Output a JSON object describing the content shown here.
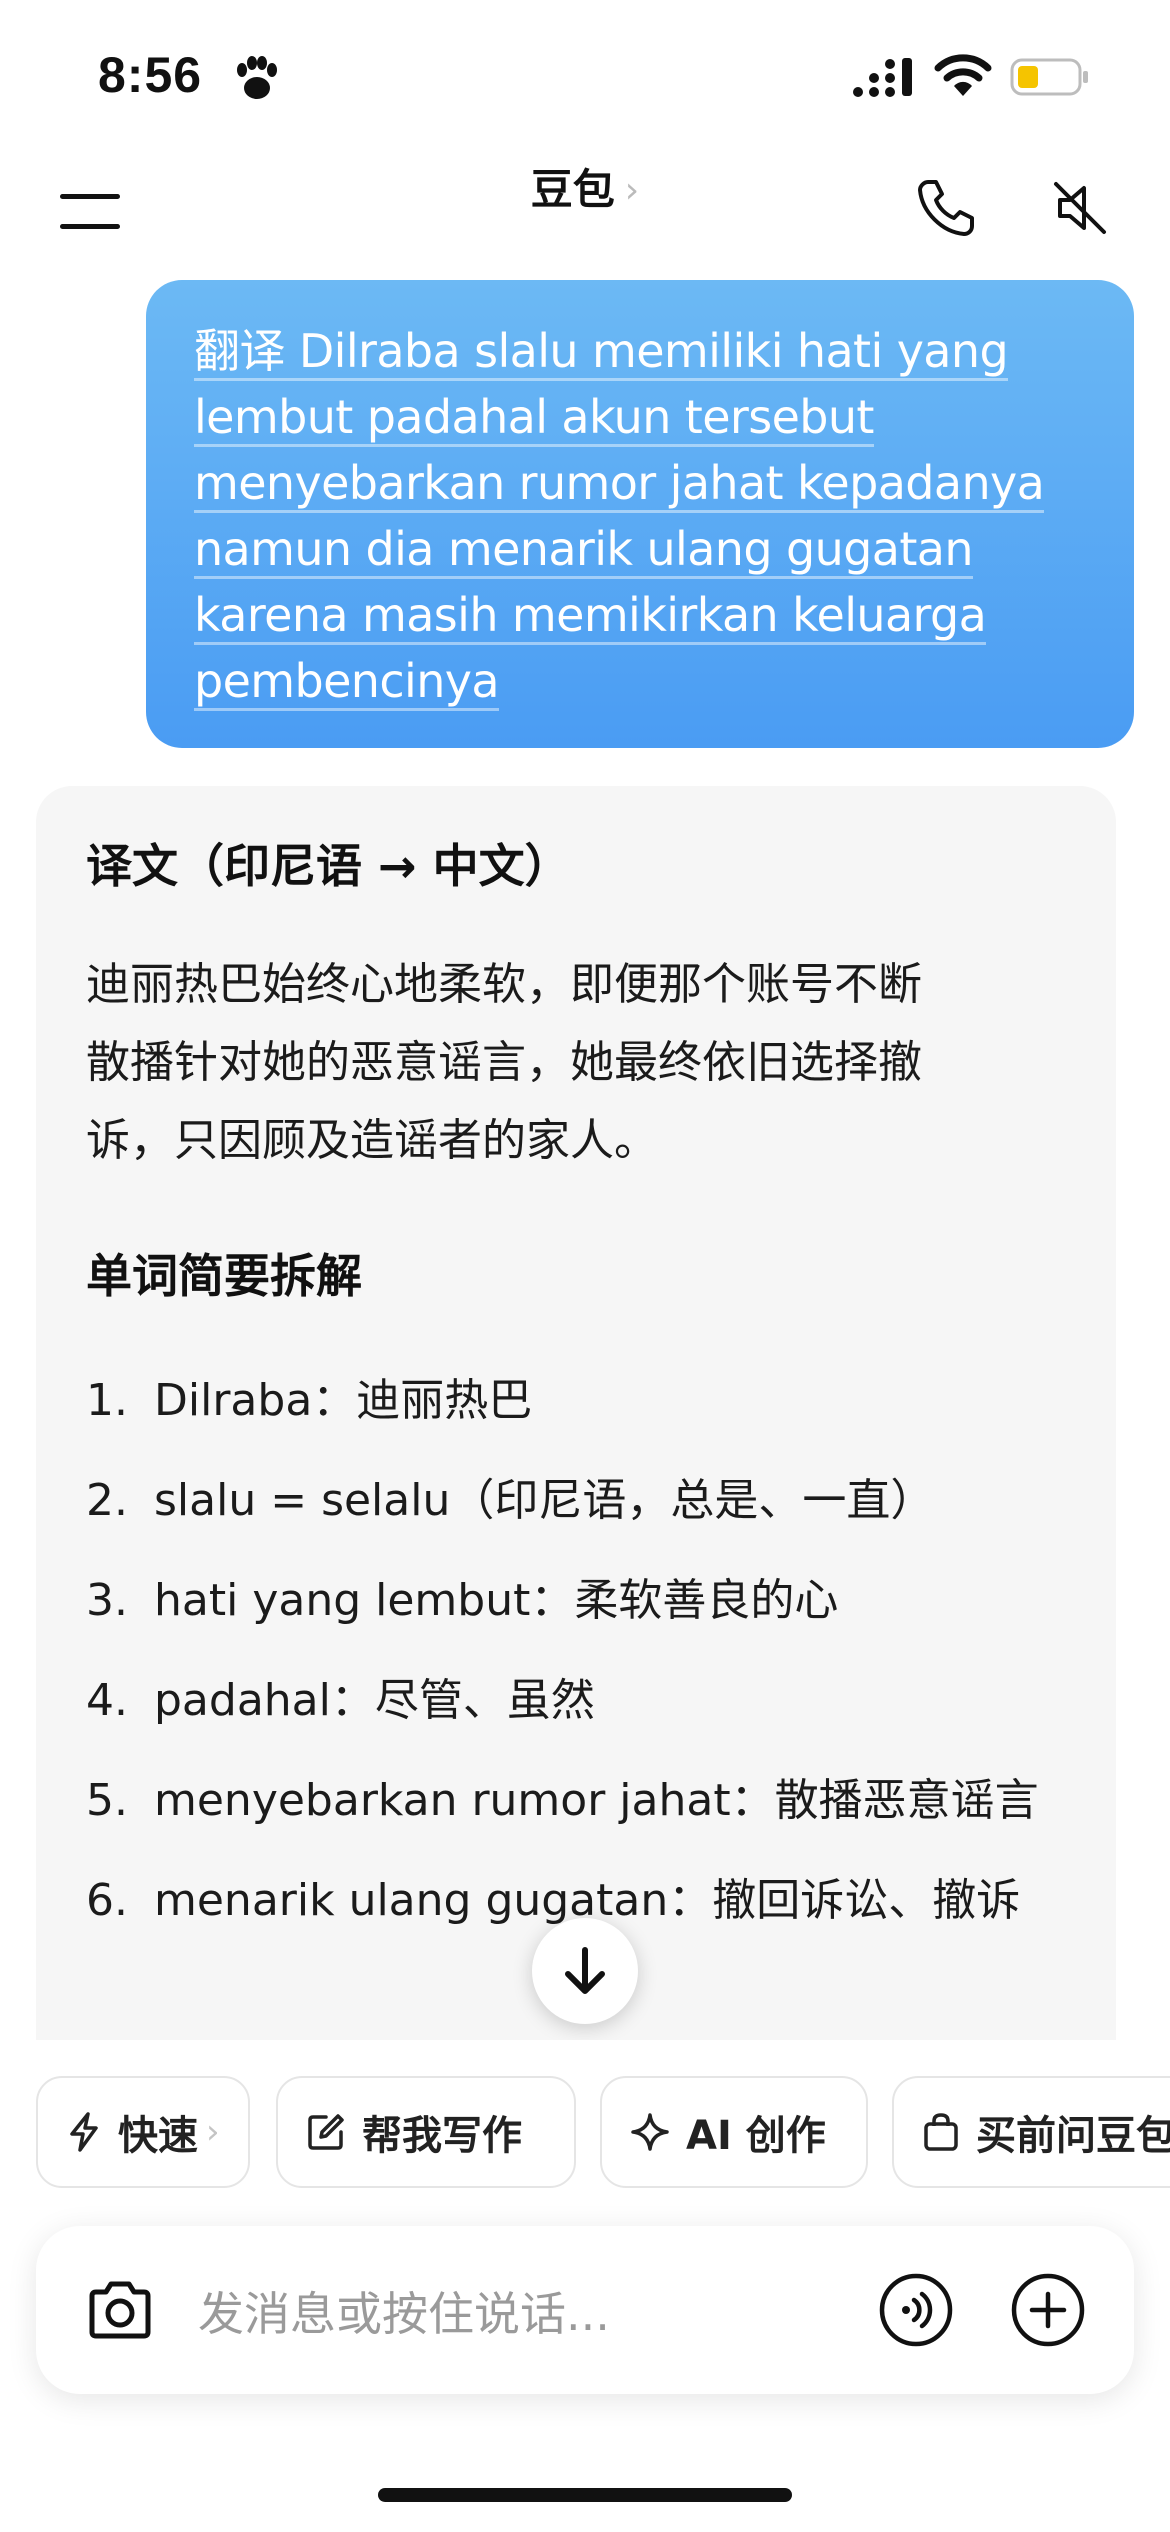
{
  "status_bar": {
    "time": "8:56",
    "battery_color": "#f5c400"
  },
  "header": {
    "title": "豆包",
    "chevron": "›"
  },
  "user_message": {
    "lines": [
      "翻译 Dilraba slalu memiliki hati yang",
      "lembut padahal akun tersebut",
      "menyebarkan rumor jahat kepadanya",
      "namun dia menarik ulang gugatan",
      "karena masih memikirkan keluarga",
      "pembencinya"
    ]
  },
  "answer": {
    "heading": "译文（印尼语 → 中文）",
    "translation_lines": [
      "迪丽热巴始终心地柔软，即便那个账号不断",
      "散播针对她的恶意谣言，她最终依旧选择撤",
      "诉，只因顾及造谣者的家人。"
    ],
    "breakdown_heading": "单词简要拆解",
    "items": [
      {
        "num": "1.",
        "text": "Dilraba：迪丽热巴"
      },
      {
        "num": "2.",
        "text": "slalu = selalu（印尼语，总是、一直）"
      },
      {
        "num": "3.",
        "text": "hati yang lembut：柔软善良的心"
      },
      {
        "num": "4.",
        "text": "padahal：尽管、虽然"
      },
      {
        "num": "5.",
        "text": "menyebarkan rumor jahat：散播恶意谣言"
      },
      {
        "num": "6.",
        "text": "menarik ulang gugatan：撤回诉讼、撤诉"
      }
    ]
  },
  "chips": [
    {
      "label": "快速",
      "icon": "lightning-icon",
      "chevron": "›"
    },
    {
      "label": "帮我写作",
      "icon": "edit-icon"
    },
    {
      "label": "AI 创作",
      "icon": "sparkle-icon"
    },
    {
      "label": "买前问豆包",
      "icon": "shopping-bag-icon"
    }
  ],
  "input": {
    "placeholder": "发消息或按住说话..."
  },
  "colors": {
    "accent": "#4a9cf3",
    "card_bg": "#f6f6f6"
  }
}
